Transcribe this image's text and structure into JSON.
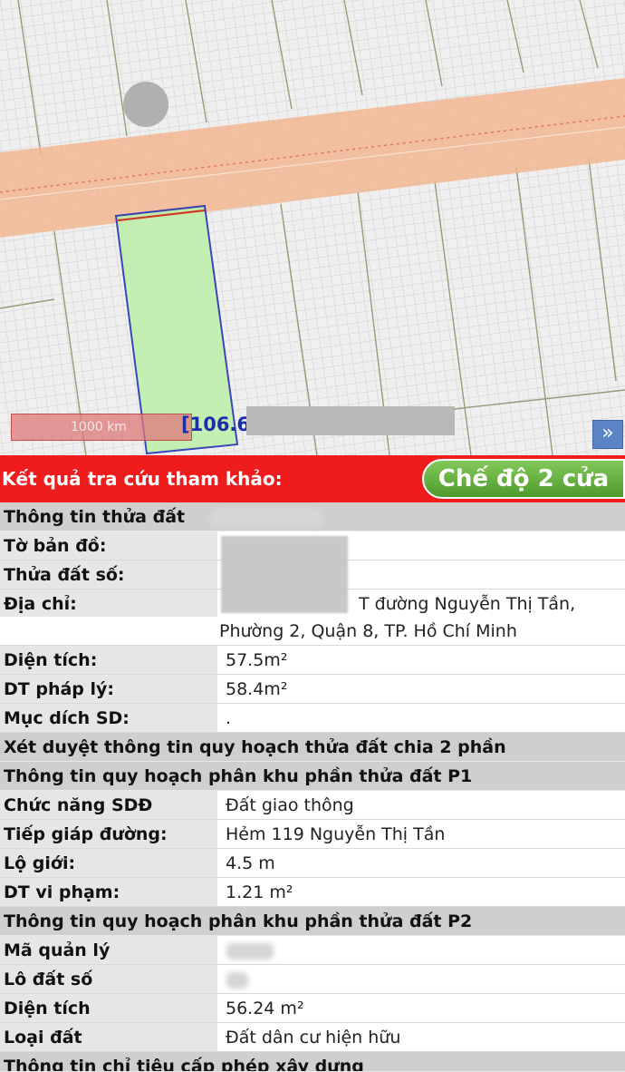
{
  "map": {
    "scale_label": "1000 km",
    "coordinate_prefix": "[106.6",
    "expand_icon": "»",
    "colors": {
      "road": "#f2b48c",
      "parcel_fill": "#bdf0a9",
      "parcel_outline": "#1a2bb0",
      "grid": "#cfcfcf"
    }
  },
  "result": {
    "title": "Kết quả tra cứu tham khảo:",
    "mode_button": "Chế độ 2 cửa"
  },
  "info": {
    "header_parcel": "Thông tin thửa đất",
    "map_sheet_label": "Tờ bản đồ:",
    "parcel_no_label": "Thửa đất số:",
    "address_label": "Địa chỉ:",
    "address_line1": "T đường Nguyễn Thị Tần,",
    "address_line2": "Phường 2, Quận 8, TP. Hồ Chí Minh",
    "area_label": "Diện tích:",
    "area_value": "57.5m²",
    "legal_area_label": "DT pháp lý:",
    "legal_area_value": "58.4m²",
    "purpose_label": "Mục dích SD:",
    "purpose_value": ".",
    "review_header": "Xét duyệt thông tin quy hoạch thửa đất chia 2 phần",
    "p1_header": "Thông tin quy hoạch phân khu phần thửa đất P1",
    "function_label": "Chức năng SDĐ",
    "function_value": "Đất giao thông",
    "adjacent_label": "Tiếp giáp đường:",
    "adjacent_value": "Hẻm 119 Nguyễn Thị Tần",
    "boundary_label": "Lộ giới:",
    "boundary_value": "4.5 m",
    "violation_label": "DT vi phạm:",
    "violation_value": "1.21 m²",
    "p2_header": "Thông tin quy hoạch phân khu phần thửa đất P2",
    "mgmt_code_label": "Mã quản lý",
    "lot_no_label": "Lô đất số",
    "area2_label": "Diện tích",
    "area2_value": "56.24 m²",
    "land_type_label": "Loại đất",
    "land_type_value": "Đất dân cư hiện hữu",
    "permit_header": "Thông tin chỉ tiêu cấp phép xây dựng"
  }
}
